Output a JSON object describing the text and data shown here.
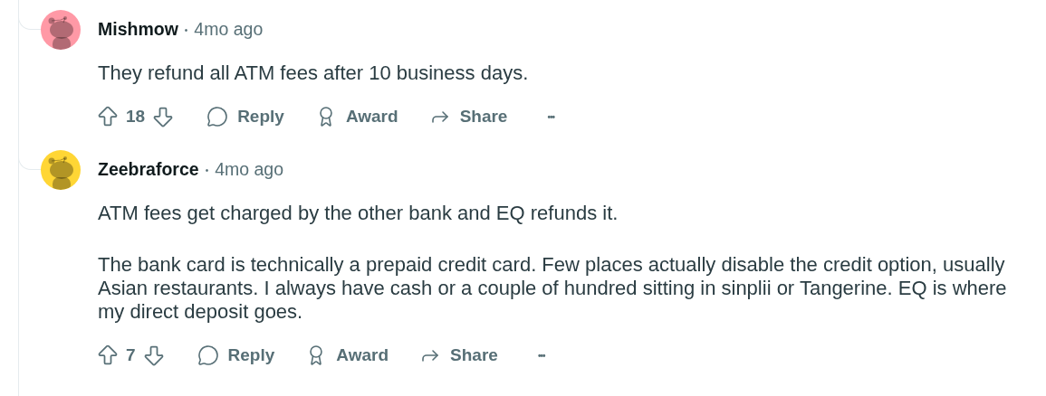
{
  "comments": [
    {
      "author": "Mishmow",
      "separator": "•",
      "time": "4mo ago",
      "color": "#ff99a6",
      "paragraphs": [
        "They refund all ATM fees after 10 business days."
      ],
      "votes": "18",
      "actions": [
        "Reply",
        "Award",
        "Share"
      ],
      "more": "•••"
    },
    {
      "author": "Zeebraforce",
      "separator": "•",
      "time": "4mo ago",
      "color": "#ffd635",
      "paragraphs": [
        "ATM fees get charged by the other bank and EQ refunds it.",
        "The bank card is technically a prepaid credit card. Few places actually disable the credit option, usually Asian restaurants. I always have cash or a couple of hundred sitting in sinplii or Tangerine. EQ is where my direct deposit goes."
      ],
      "votes": "7",
      "actions": [
        "Reply",
        "Award",
        "Share"
      ],
      "more": "•••"
    }
  ]
}
